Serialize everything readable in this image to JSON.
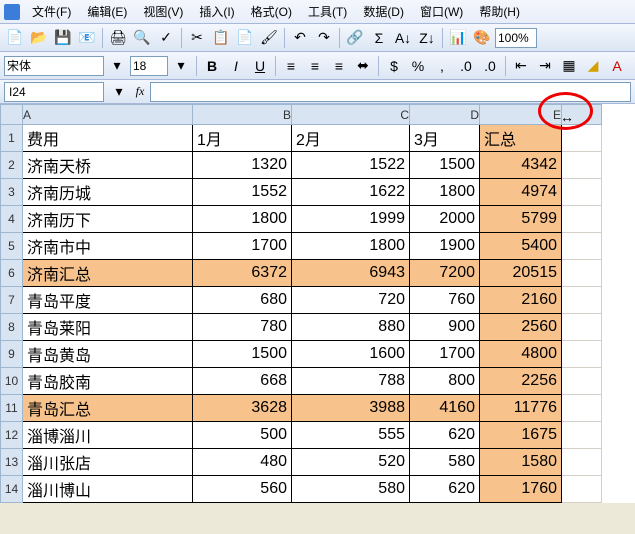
{
  "menu": {
    "file": "文件(F)",
    "edit": "编辑(E)",
    "view": "视图(V)",
    "insert": "插入(I)",
    "format": "格式(O)",
    "tools": "工具(T)",
    "data": "数据(D)",
    "window": "窗口(W)",
    "help": "帮助(H)"
  },
  "toolbar": {
    "zoom": "100%"
  },
  "format": {
    "font_name": "宋体",
    "font_size": "18"
  },
  "formula_bar": {
    "name_box": "I24",
    "fx": "fx"
  },
  "columns": {
    "A": "A",
    "B": "B",
    "C": "C",
    "D": "D",
    "E": "E"
  },
  "chart_data": {
    "type": "table",
    "header": {
      "a": "费用",
      "b": "1月",
      "c": "2月",
      "d": "3月",
      "e": "汇总"
    },
    "rows": [
      {
        "a": "济南天桥",
        "b": 1320,
        "c": 1522,
        "d": 1500,
        "e": 4342,
        "sum": false
      },
      {
        "a": "济南历城",
        "b": 1552,
        "c": 1622,
        "d": 1800,
        "e": 4974,
        "sum": false
      },
      {
        "a": "济南历下",
        "b": 1800,
        "c": 1999,
        "d": 2000,
        "e": 5799,
        "sum": false
      },
      {
        "a": "济南市中",
        "b": 1700,
        "c": 1800,
        "d": 1900,
        "e": 5400,
        "sum": false
      },
      {
        "a": "济南汇总",
        "b": 6372,
        "c": 6943,
        "d": 7200,
        "e": 20515,
        "sum": true
      },
      {
        "a": "青岛平度",
        "b": 680,
        "c": 720,
        "d": 760,
        "e": 2160,
        "sum": false
      },
      {
        "a": "青岛莱阳",
        "b": 780,
        "c": 880,
        "d": 900,
        "e": 2560,
        "sum": false
      },
      {
        "a": "青岛黄岛",
        "b": 1500,
        "c": 1600,
        "d": 1700,
        "e": 4800,
        "sum": false
      },
      {
        "a": "青岛胶南",
        "b": 668,
        "c": 788,
        "d": 800,
        "e": 2256,
        "sum": false
      },
      {
        "a": "青岛汇总",
        "b": 3628,
        "c": 3988,
        "d": 4160,
        "e": 11776,
        "sum": true
      },
      {
        "a": "淄博淄川",
        "b": 500,
        "c": 555,
        "d": 620,
        "e": 1675,
        "sum": false
      },
      {
        "a": "淄川张店",
        "b": 480,
        "c": 520,
        "d": 580,
        "e": 1580,
        "sum": false
      },
      {
        "a": "淄川博山",
        "b": 560,
        "c": 580,
        "d": 620,
        "e": 1760,
        "sum": false
      }
    ]
  }
}
